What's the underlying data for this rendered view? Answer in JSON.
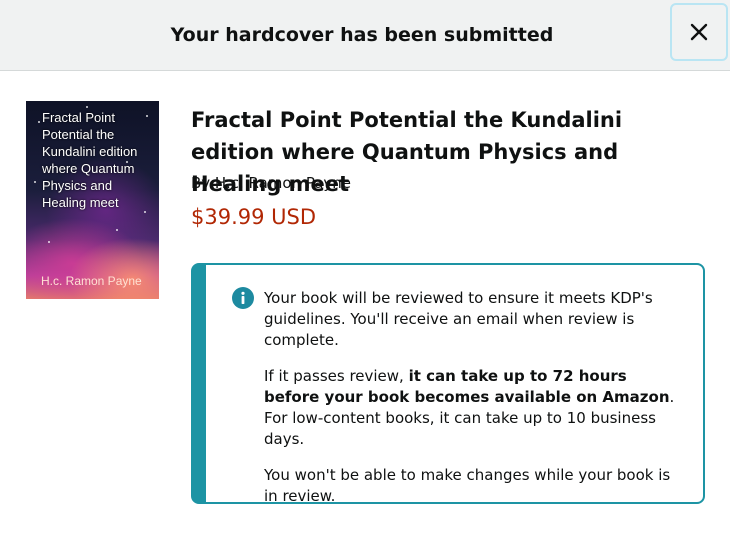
{
  "header": {
    "title": "Your hardcover has been submitted"
  },
  "book": {
    "cover": {
      "title": "Fractal Point Potential the Kundalini edition where Quantum Physics and Healing meet",
      "author": "H.c. Ramon Payne"
    },
    "title": "Fractal Point Potential the Kundalini edition where Quantum Physics and Healing meet",
    "author_line": "By H.c. Ramon Payne",
    "price": "$39.99 USD"
  },
  "notice": {
    "icon": "info-icon",
    "p1": "Your book will be reviewed to ensure it meets KDP's guidelines. You'll receive an email when review is complete.",
    "p2_pre": "If it passes review, ",
    "p2_bold": "it can take up to 72 hours before your book becomes available on Amazon",
    "p2_post": ". For low-content books, it can take up to 10 business days.",
    "p3": "You won't be able to make changes while your book is in review."
  },
  "colors": {
    "accent": "#1d94a4",
    "price": "#b12704",
    "header_bg": "#f0f2f2"
  }
}
